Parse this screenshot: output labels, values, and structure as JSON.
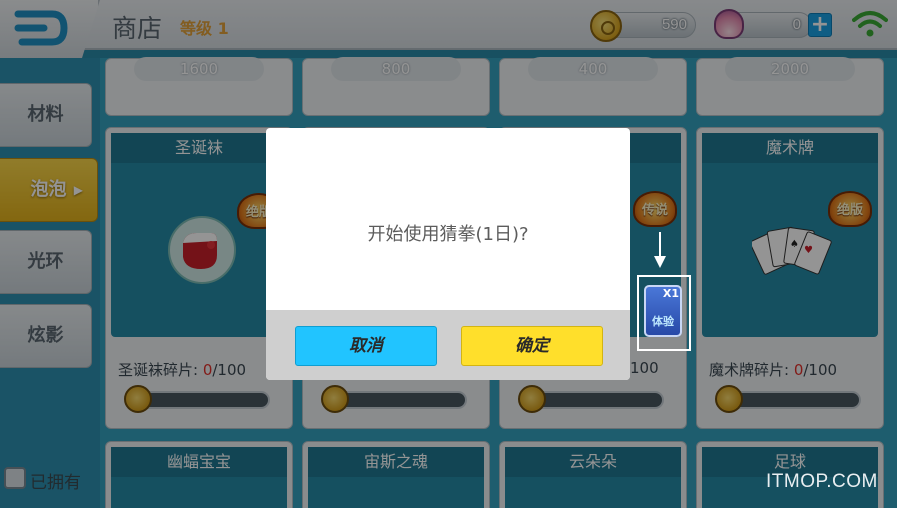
{
  "header": {
    "title": "商店",
    "level": "等级 1",
    "coins": "590",
    "shells": "0",
    "plus_label": "+"
  },
  "sidebar": {
    "tabs": [
      {
        "label": "材料"
      },
      {
        "label": "泡泡",
        "active": true
      },
      {
        "label": "光环"
      },
      {
        "label": "炫影"
      }
    ],
    "owned_label": "已拥有"
  },
  "grid": {
    "top_prices": [
      "1600",
      "800",
      "400",
      "2000"
    ],
    "cards_row1": [
      {
        "name": "圣诞袜",
        "badge": "绝版",
        "fragment_label": "圣诞袜碎片: ",
        "fragment_have": "0",
        "fragment_total": "/100"
      },
      {
        "name": "",
        "badge": "",
        "fragment_label": "",
        "fragment_have": "",
        "fragment_total": ""
      },
      {
        "name": "",
        "badge": "传说",
        "fragment_label": "",
        "fragment_have": "",
        "fragment_total": "100"
      },
      {
        "name": "魔术牌",
        "badge": "绝版",
        "fragment_label": "魔术牌碎片: ",
        "fragment_have": "0",
        "fragment_total": "/100"
      }
    ],
    "cards_row2": [
      {
        "name": "幽蝠宝宝"
      },
      {
        "name": "宙斯之魂"
      },
      {
        "name": "云朵朵"
      },
      {
        "name": "足球"
      }
    ]
  },
  "dialog": {
    "message": "开始使用猜拳(1日)?",
    "cancel_label": "取消",
    "confirm_label": "确定"
  },
  "highlight_item": {
    "count": "X1",
    "label": "体验"
  },
  "watermark": "ITMOP.COM",
  "colors": {
    "cancel_button": "#21c4ff",
    "confirm_button": "#ffdf2b",
    "active_tab": "#f2c630",
    "fragment_zero": "#e1302a"
  }
}
